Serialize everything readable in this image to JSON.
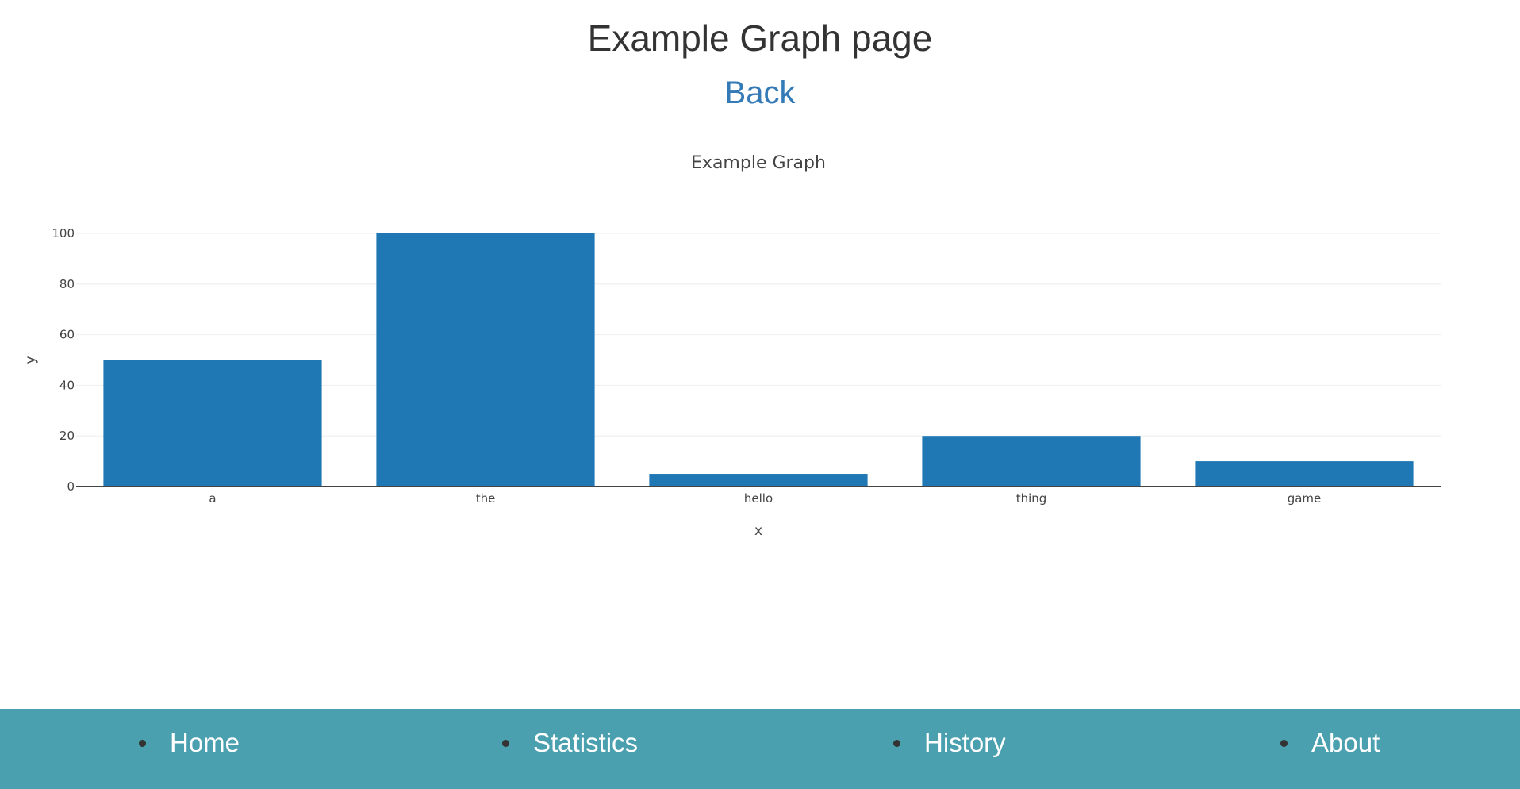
{
  "page": {
    "title": "Example Graph page",
    "back_label": "Back"
  },
  "colors": {
    "bar": "#1f77b4",
    "link": "#337ab7",
    "navbar": "#4ba0b0",
    "grid": "#eeeeee",
    "axis": "#444444"
  },
  "chart_data": {
    "type": "bar",
    "title": "Example Graph",
    "xlabel": "x",
    "ylabel": "y",
    "categories": [
      "a",
      "the",
      "hello",
      "thing",
      "game"
    ],
    "values": [
      50,
      100,
      5,
      20,
      10
    ],
    "ylim": [
      0,
      100
    ],
    "yticks": [
      0,
      20,
      40,
      60,
      80,
      100
    ],
    "grid": true,
    "legend": "none"
  },
  "nav": {
    "items": [
      {
        "label": "Home"
      },
      {
        "label": "Statistics"
      },
      {
        "label": "History"
      },
      {
        "label": "About"
      }
    ]
  }
}
